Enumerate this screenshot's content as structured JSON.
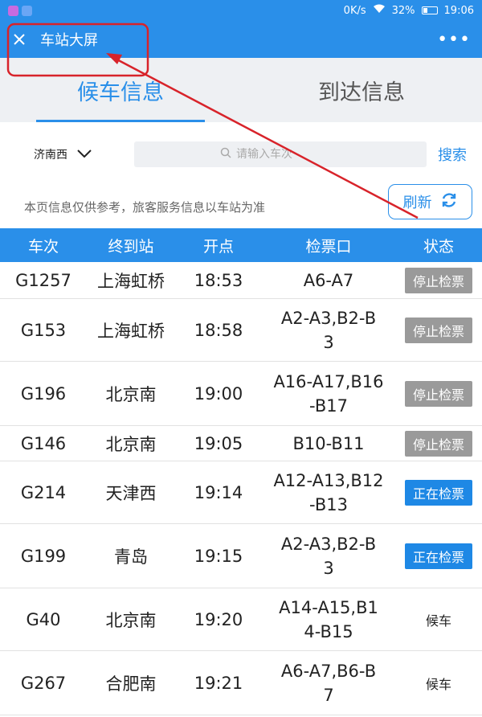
{
  "status_bar": {
    "network": "0K/s",
    "battery": "32%",
    "time": "19:06",
    "battery_level": 0.32
  },
  "app_bar": {
    "title": "车站大屏",
    "close_icon": "close-icon",
    "more_icon": "more-dots-icon"
  },
  "tabs": [
    {
      "label": "候车信息",
      "active": true
    },
    {
      "label": "到达信息",
      "active": false
    }
  ],
  "search": {
    "station": "济南西",
    "placeholder": "请输入车次",
    "button": "搜索"
  },
  "notice": "本页信息仅供参考，旅客服务信息以车站为准",
  "refresh": {
    "label": "刷新"
  },
  "table": {
    "headers": [
      "车次",
      "终到站",
      "开点",
      "检票口",
      "状态"
    ],
    "rows": [
      {
        "train": "G1257",
        "dest": "上海虹桥",
        "time": "18:53",
        "gate_lines": [
          "A6-A7"
        ],
        "status": "停止检票",
        "kind": "stopped"
      },
      {
        "train": "G153",
        "dest": "上海虹桥",
        "time": "18:58",
        "gate_lines": [
          "A2-A3,B2-B",
          "3"
        ],
        "status": "停止检票",
        "kind": "stopped"
      },
      {
        "train": "G196",
        "dest": "北京南",
        "time": "19:00",
        "gate_lines": [
          "A16-A17,B16",
          "-B17"
        ],
        "status": "停止检票",
        "kind": "stopped"
      },
      {
        "train": "G146",
        "dest": "北京南",
        "time": "19:05",
        "gate_lines": [
          "B10-B11"
        ],
        "status": "停止检票",
        "kind": "stopped"
      },
      {
        "train": "G214",
        "dest": "天津西",
        "time": "19:14",
        "gate_lines": [
          "A12-A13,B12",
          "-B13"
        ],
        "status": "正在检票",
        "kind": "active"
      },
      {
        "train": "G199",
        "dest": "青岛",
        "time": "19:15",
        "gate_lines": [
          "A2-A3,B2-B",
          "3"
        ],
        "status": "正在检票",
        "kind": "active"
      },
      {
        "train": "G40",
        "dest": "北京南",
        "time": "19:20",
        "gate_lines": [
          "A14-A15,B1",
          "4-B15"
        ],
        "status": "候车",
        "kind": "waiting"
      },
      {
        "train": "G267",
        "dest": "合肥南",
        "time": "19:21",
        "gate_lines": [
          "A6-A7,B6-B",
          "7"
        ],
        "status": "候车",
        "kind": "waiting"
      }
    ]
  },
  "colors": {
    "primary": "#2a8fe9",
    "badge_stopped": "#9a9a9a",
    "badge_active": "#1e88e5",
    "annotation": "#d8232a"
  }
}
